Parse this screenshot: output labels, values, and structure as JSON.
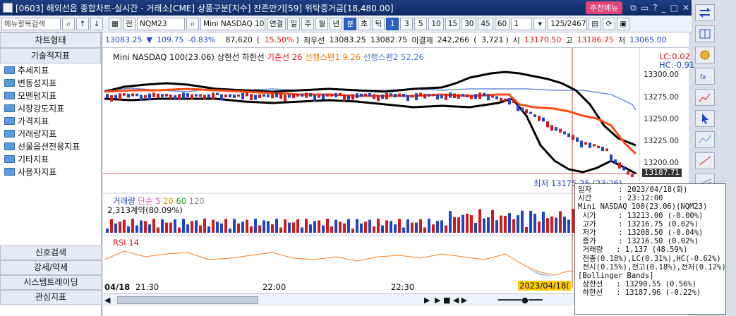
{
  "window": {
    "title": "[0603] 해외선옵 종합차트-실시간 - 거래소[CME] 상품구분[지수] 잔존만기[59] 위탁증거금[18,480.00]",
    "recommend_menu": "추천메뉴"
  },
  "toolbar": {
    "menu_search_placeholder": "메뉴항목검색",
    "period_label": "전",
    "symbol": "NQM23",
    "product_name": "Mini NASDAQ 100(23.0",
    "buttons": [
      "연결",
      "일",
      "주",
      "월",
      "년",
      "분",
      "초",
      "틱"
    ],
    "intervals": [
      "1",
      "3",
      "5",
      "10",
      "15",
      "30",
      "45",
      "60"
    ],
    "interval_value": "1",
    "page_counter": "125/2467"
  },
  "quote": {
    "price": "13083.25",
    "change": "109.75",
    "change_pct": "-0.83%",
    "volume": "87,620",
    "volume_pct": "15.50%",
    "best_bid_label": "최우선",
    "best_bid": "13083.25",
    "best_ask": "13082.75",
    "open_int_label": "미결제",
    "open_int": "242,266",
    "open_int_change": "3,721",
    "open_label": "시",
    "open": "13170.50",
    "high_label": "고",
    "high": "13186.75",
    "low_label": "저",
    "low": "13065.00"
  },
  "left_panel": {
    "header_chart": "차트형태",
    "header_indicator": "기술적지표",
    "tree": [
      "추세지표",
      "변동성지표",
      "모멘텀지표",
      "시장강도지표",
      "가격지표",
      "거래량지표",
      "선물옵션전용지표",
      "기타지표",
      "사용자지표"
    ],
    "bottom": [
      "신호검색",
      "강세/약세",
      "시스템트레이딩",
      "관심지표"
    ]
  },
  "price_pane": {
    "series_label": "Mini NASDAQ 100(23.06)",
    "upper_label": "상한선",
    "lower_label": "하한선",
    "base_label": "기준선 26",
    "span1_label": "선행스팬1 9.26",
    "span2_label": "선행스팬2 52.26",
    "lc": "LC:0.02",
    "hc": "HC:-0.91",
    "min_label": "최저 13175.25 (23:26)",
    "current_tag": "13187.71",
    "y_ticks": [
      "13300.00",
      "13275.00",
      "13250.00",
      "13225.00",
      "13200.00"
    ]
  },
  "volume_pane": {
    "label": "거래량",
    "ma_label": "단순 5",
    "ma20": "20",
    "ma60": "60",
    "ma120": "120",
    "contracts": "2,313계약(80.09%)"
  },
  "rsi_pane": {
    "label": "RSI 14"
  },
  "xaxis": {
    "date": "04/18",
    "times": [
      "21:30",
      "22:00",
      "22:30"
    ],
    "cursor_time": "2023/04/18("
  },
  "tooltip": {
    "text": "일자      : 2023/04/18(화)\n시간      : 23:12:00\nMini NASDAQ 100(23.06)(NQM23)\n 시가     : 13213.00 (-0.00%)\n 고가     : 13216.75 (0.02%)\n 저가     : 13208.50 (-0.04%)\n 종가     : 13216.50 (0.02%)\n 거래량   : 1,137 (48.59%)\n 전종(0.18%),LC(0.31%),HC(-0.62%)\n 전시(0.15%),전고(0.18%),전저(0.12%)\n[Bollinger Bands]\n 상한선   : 13290.55 (0.56%)\n 하한선   : 13187.96 (-0.22%)"
  },
  "colors": {
    "title_bg": "#0f2a63",
    "candle_up": "#d11a1a",
    "candle_down": "#1b47c6",
    "ichimoku_base": "#ff4a12",
    "bollinger": "#000000",
    "span_line": "#6a8fd8"
  }
}
